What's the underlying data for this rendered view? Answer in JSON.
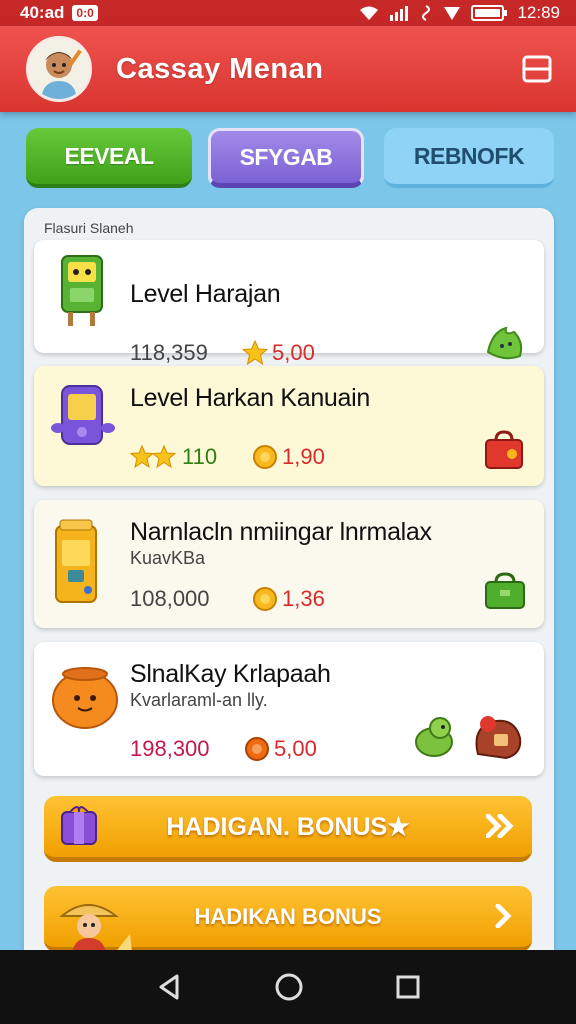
{
  "status_bar": {
    "time_left": "40:ad",
    "chip": "0:0",
    "time_right": "12:89"
  },
  "header": {
    "title": "Cassay Menan"
  },
  "tabs": [
    {
      "label": "EEVEAL"
    },
    {
      "label": "SFYGAB"
    },
    {
      "label": "REBNOFK"
    }
  ],
  "panel": {
    "caption": "Flasuri Slaneh",
    "cards": [
      {
        "title": "Level Harajan",
        "subtitle": "",
        "stat1": "118,359",
        "stat2": "5,00",
        "stat2_icon": "star-icon",
        "reward_icon": "green-leaf-icon"
      },
      {
        "title": "Level Harkan Kanuain",
        "subtitle": "",
        "stat1": "110",
        "stat1_icon": "stars-icon",
        "stat2": "1,90",
        "stat2_icon": "coin-icon",
        "reward_icon": "red-bag-icon"
      },
      {
        "title": "Narnlacln nmiingar lnrmalax",
        "subtitle": "KuavKBa",
        "stat1": "108,000",
        "stat2": "1,36",
        "stat2_icon": "coin-icon",
        "reward_icon": "green-bag-icon"
      },
      {
        "title": "SlnalKay Krlapaah",
        "subtitle": "Kvarlaraml-an lly.",
        "stat1": "198,300",
        "stat2": "5,00",
        "stat2_icon": "orange-coin-icon",
        "reward_icon": "pets-icon"
      }
    ],
    "bonus_1": "HADIGAN. BONUS★",
    "bonus_2": "HADIKAN BONUS"
  },
  "colors": {
    "header": "#d9352f",
    "background": "#7cc6ea",
    "bonus": "#f0a000"
  }
}
